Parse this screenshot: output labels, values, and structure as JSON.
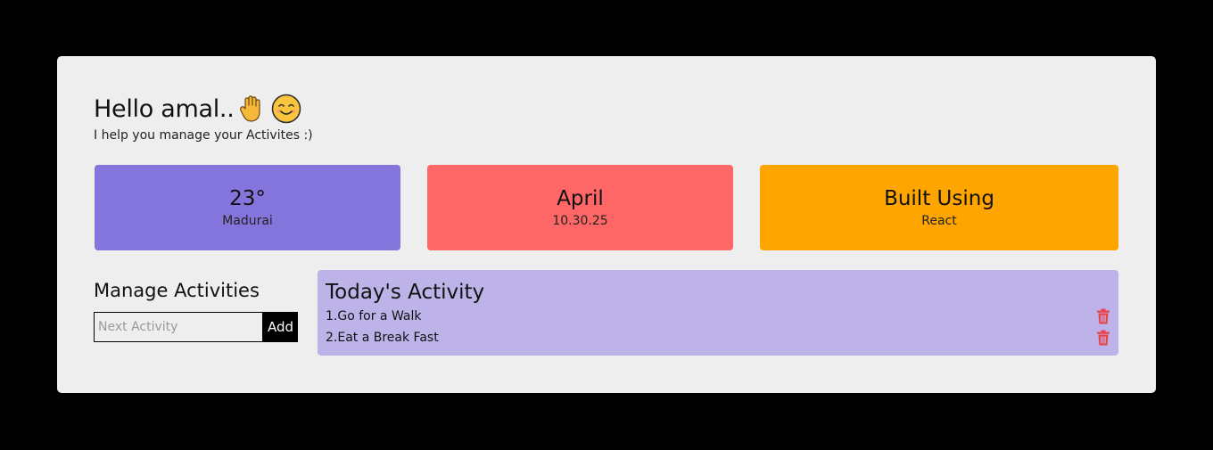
{
  "header": {
    "greeting": "Hello amal..",
    "wave_icon": "waving-hand-icon",
    "smile_icon": "smiling-face-icon",
    "subtitle": "I help you manage your Activites :)"
  },
  "cards": {
    "weather": {
      "title": "23°",
      "sub": "Madurai",
      "color": "#8475dc"
    },
    "month": {
      "title": "April",
      "sub": "10.30.25",
      "color": "#ff6666"
    },
    "built": {
      "title": "Built Using",
      "sub": "React",
      "color": "#ffa500"
    }
  },
  "manage": {
    "heading": "Manage Activities",
    "input_placeholder": "Next Activity",
    "input_value": "",
    "add_label": "Add"
  },
  "activity": {
    "heading": "Today's Activity",
    "items": [
      {
        "label": "1.Go for a Walk",
        "icon": "trash-icon"
      },
      {
        "label": "2.Eat a Break Fast",
        "icon": "trash-icon"
      }
    ],
    "delete_color": "#e8424a"
  }
}
